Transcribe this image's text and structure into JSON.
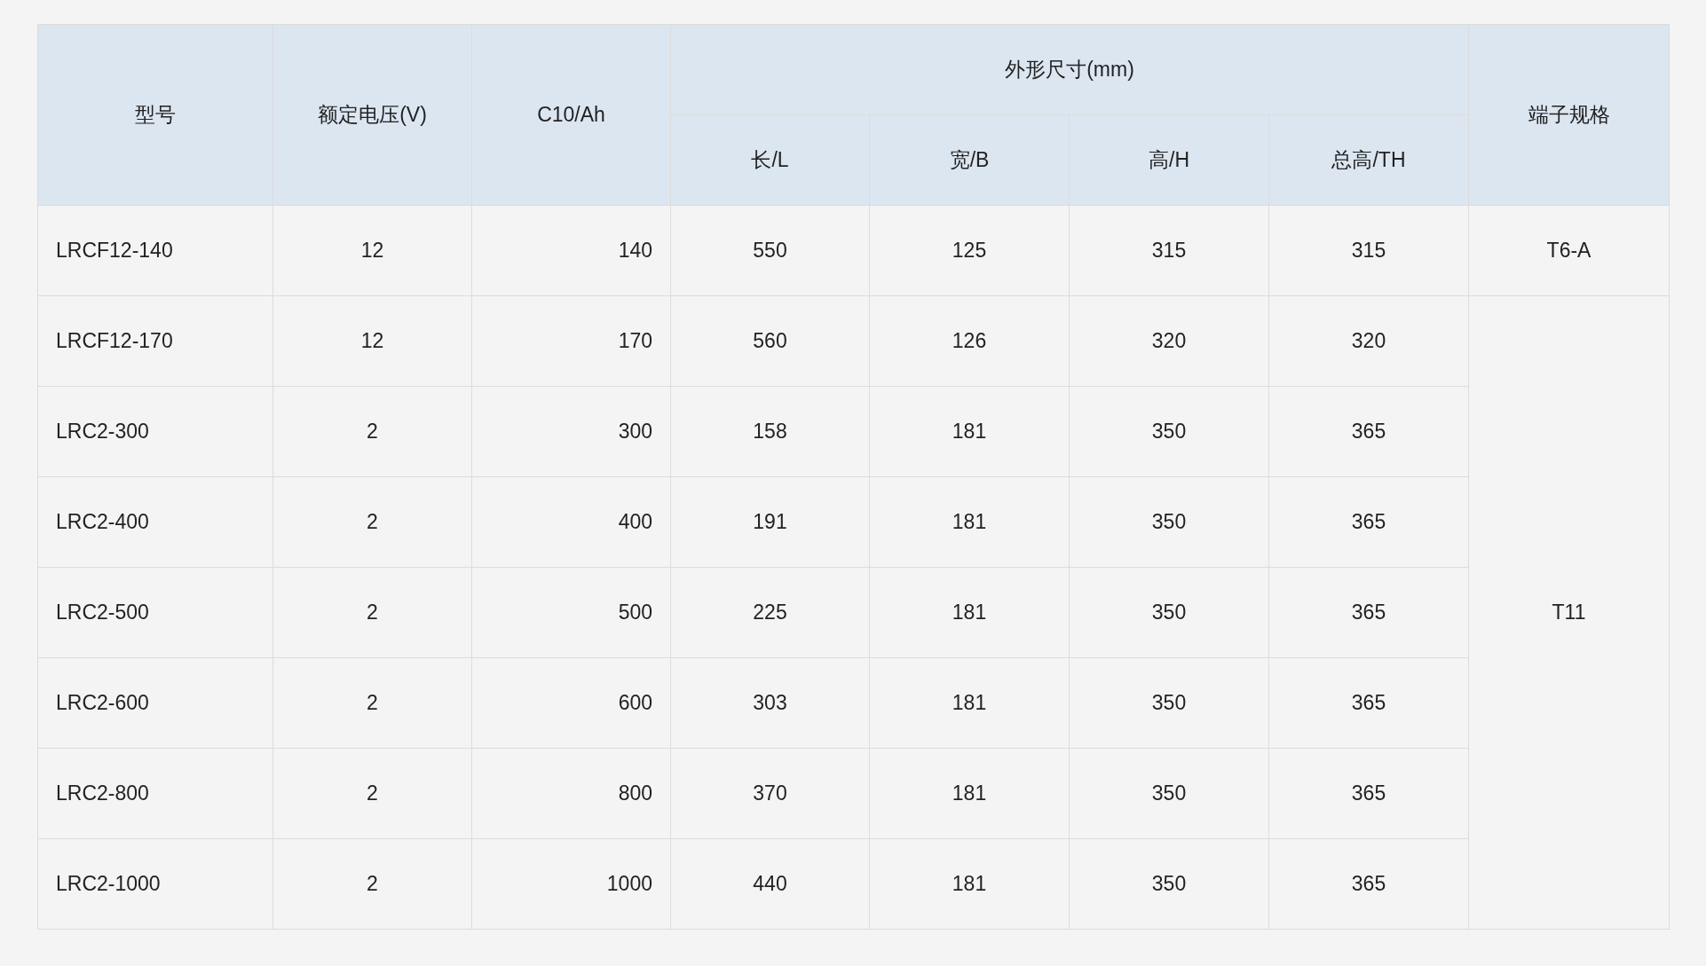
{
  "table": {
    "columns": {
      "model": "型号",
      "voltage": "额定电压(V)",
      "capacity": "C10/Ah",
      "dimensions": {
        "label": "外形尺寸(mm)",
        "sub": [
          "长/L",
          "宽/B",
          "高/H",
          "总高/TH"
        ]
      },
      "terminal": "端子规格"
    },
    "groups": [
      {
        "terminal": "T6-A",
        "rows": [
          {
            "model": "LRCF12-140",
            "voltage": "12",
            "capacity": "140",
            "dims": [
              "550",
              "125",
              "315",
              "315"
            ]
          }
        ]
      },
      {
        "terminal": "T11",
        "rows": [
          {
            "model": "LRCF12-170",
            "voltage": "12",
            "capacity": "170",
            "dims": [
              "560",
              "126",
              "320",
              "320"
            ]
          },
          {
            "model": "LRC2-300",
            "voltage": "2",
            "capacity": "300",
            "dims": [
              "158",
              "181",
              "350",
              "365"
            ]
          },
          {
            "model": "LRC2-400",
            "voltage": "2",
            "capacity": "400",
            "dims": [
              "191",
              "181",
              "350",
              "365"
            ]
          },
          {
            "model": "LRC2-500",
            "voltage": "2",
            "capacity": "500",
            "dims": [
              "225",
              "181",
              "350",
              "365"
            ]
          },
          {
            "model": "LRC2-600",
            "voltage": "2",
            "capacity": "600",
            "dims": [
              "303",
              "181",
              "350",
              "365"
            ]
          },
          {
            "model": "LRC2-800",
            "voltage": "2",
            "capacity": "800",
            "dims": [
              "370",
              "181",
              "350",
              "365"
            ]
          },
          {
            "model": "LRC2-1000",
            "voltage": "2",
            "capacity": "1000",
            "dims": [
              "440",
              "181",
              "350",
              "365"
            ]
          }
        ]
      }
    ]
  }
}
